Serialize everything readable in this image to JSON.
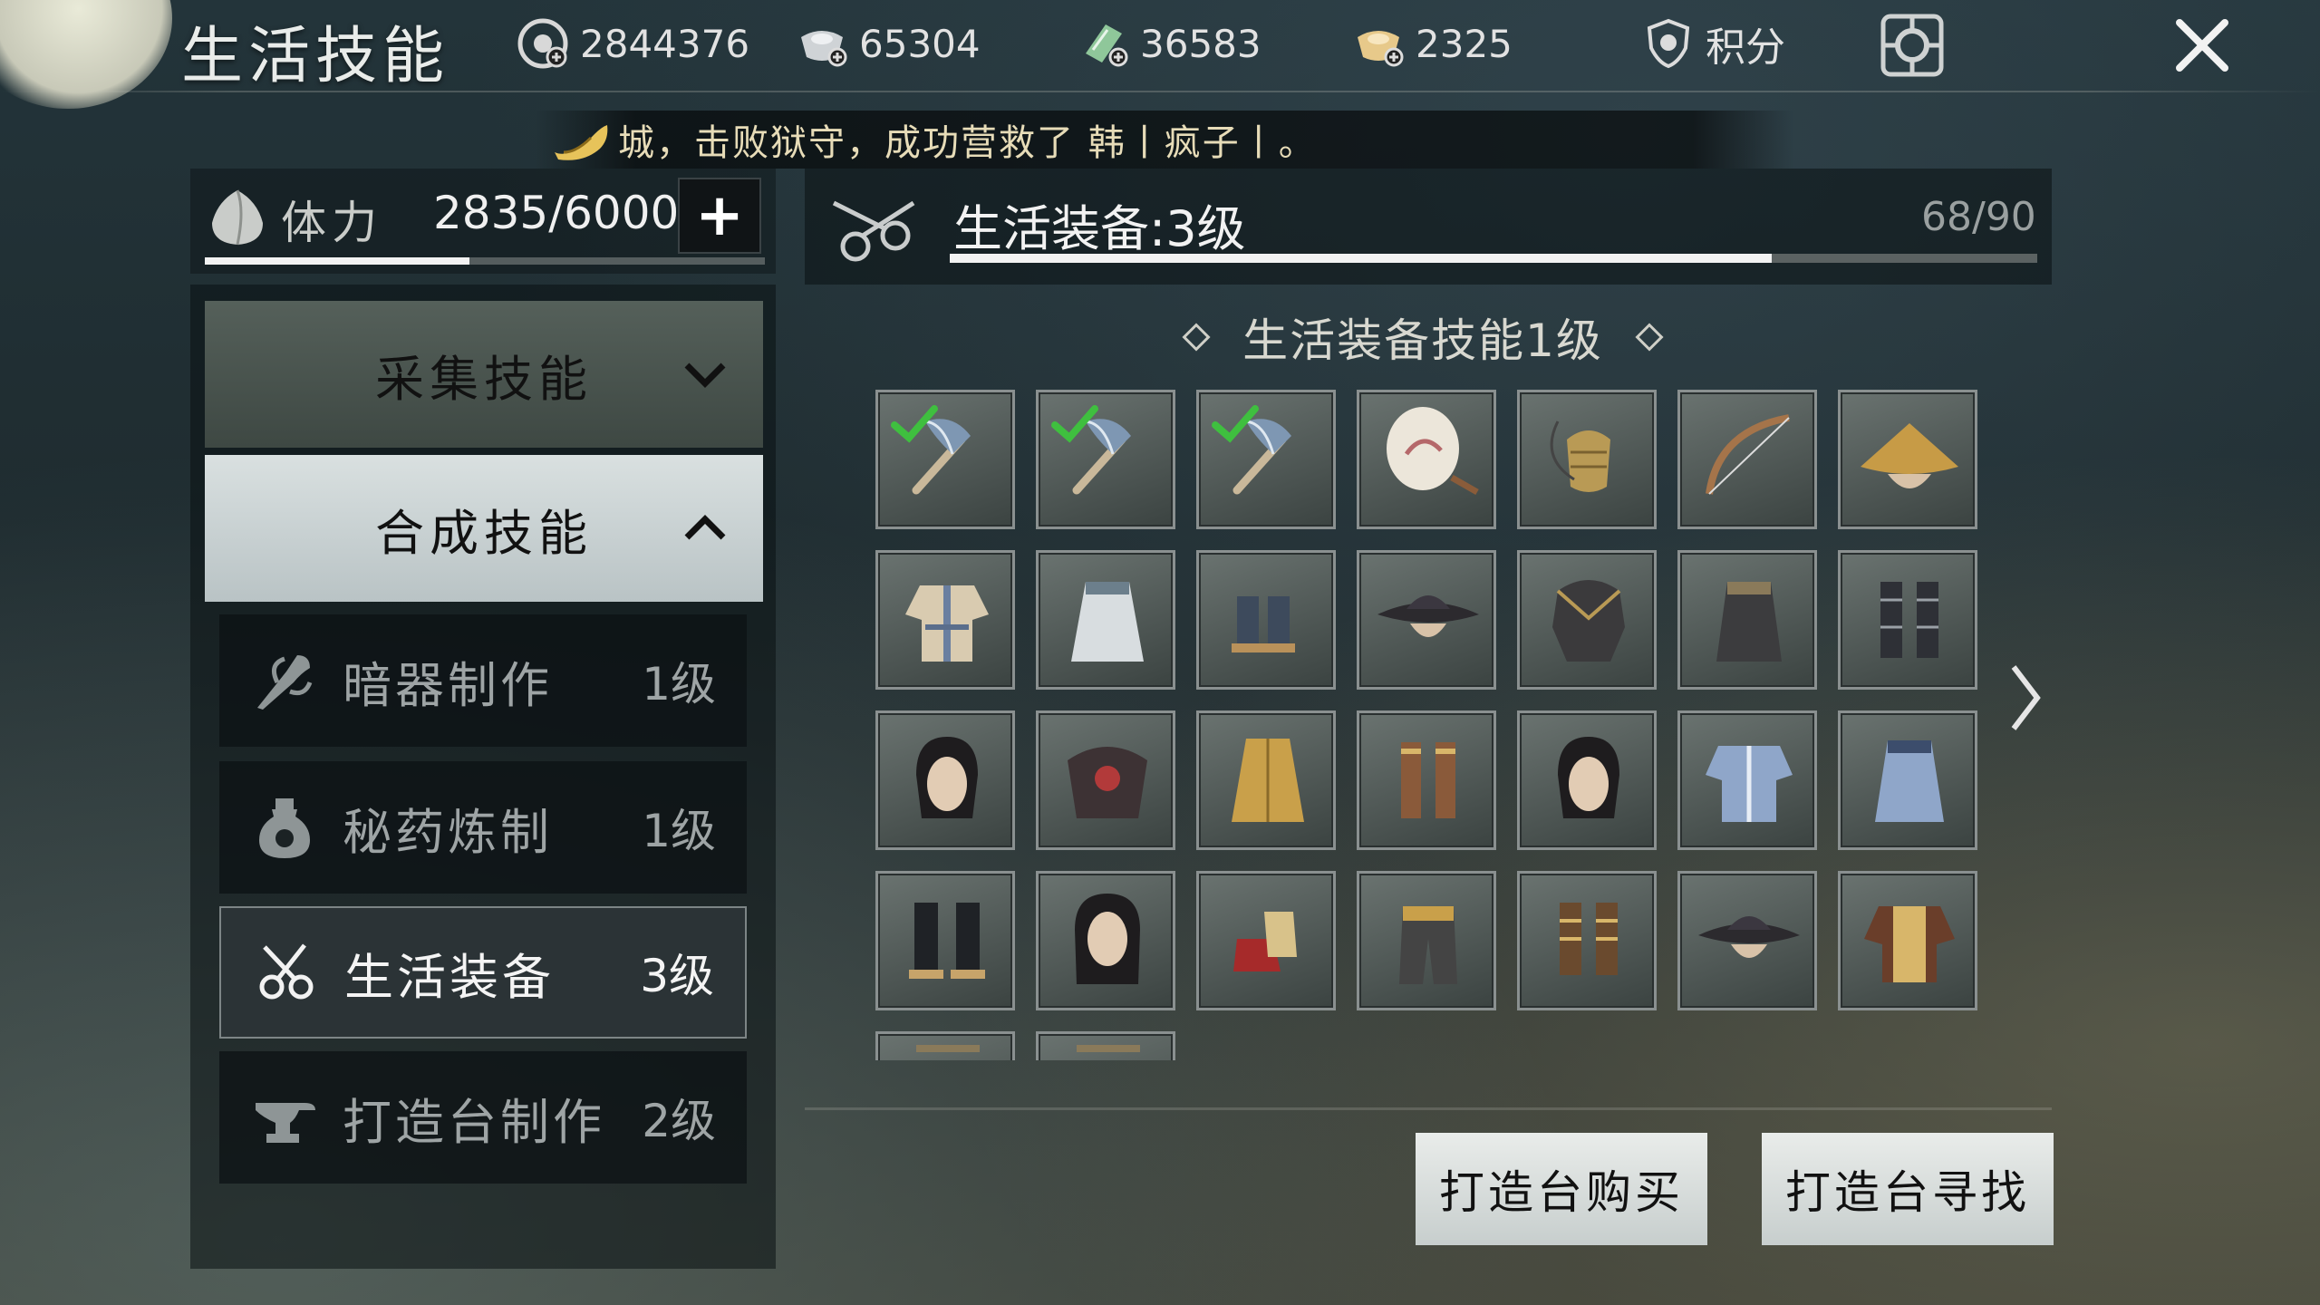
{
  "header": {
    "title": "生活技能",
    "resources": [
      {
        "icon": "coin-icon",
        "value": "2844376"
      },
      {
        "icon": "silver-ingot-icon",
        "value": "65304"
      },
      {
        "icon": "jade-icon",
        "value": "36583"
      },
      {
        "icon": "gold-ingot-icon",
        "value": "2325"
      }
    ],
    "points_label": "积分"
  },
  "marquee": {
    "text": "城，击败狱守，成功营救了 韩丨疯子丨。"
  },
  "stamina": {
    "label": "体力",
    "value": "2835/6000",
    "fraction": 0.4725
  },
  "menu": {
    "categories": [
      {
        "label": "采集技能",
        "expanded": false
      },
      {
        "label": "合成技能",
        "expanded": true
      }
    ],
    "subskills": [
      {
        "label": "暗器制作",
        "level": "1级",
        "icon": "dart-icon"
      },
      {
        "label": "秘药炼制",
        "level": "1级",
        "icon": "medicine-bottle-icon"
      },
      {
        "label": "生活装备",
        "level": "3级",
        "icon": "scissors-icon",
        "active": true
      },
      {
        "label": "打造台制作",
        "level": "2级",
        "icon": "anvil-icon"
      }
    ]
  },
  "skill": {
    "title": "生活装备:3级",
    "progress_text": "68/90",
    "progress_fraction": 0.7556,
    "section_title": "生活装备技能1级"
  },
  "grid": {
    "items": [
      {
        "icon": "axe-icon",
        "unlocked": true
      },
      {
        "icon": "axe-icon",
        "unlocked": true
      },
      {
        "icon": "axe-icon",
        "unlocked": true
      },
      {
        "icon": "fan-icon"
      },
      {
        "icon": "fish-basket-icon"
      },
      {
        "icon": "bow-icon"
      },
      {
        "icon": "straw-hat-icon"
      },
      {
        "icon": "robe-icon"
      },
      {
        "icon": "white-skirt-icon"
      },
      {
        "icon": "shoes-icon"
      },
      {
        "icon": "dark-hat-icon"
      },
      {
        "icon": "armor-icon"
      },
      {
        "icon": "dark-skirt-icon"
      },
      {
        "icon": "greaves-icon"
      },
      {
        "icon": "hairstyle-icon"
      },
      {
        "icon": "fur-armor-icon"
      },
      {
        "icon": "gold-skirt-icon"
      },
      {
        "icon": "bracers-icon"
      },
      {
        "icon": "hairstyle-icon"
      },
      {
        "icon": "blue-armor-icon"
      },
      {
        "icon": "blue-skirt-icon"
      },
      {
        "icon": "boots-icon"
      },
      {
        "icon": "long-hair-icon"
      },
      {
        "icon": "red-shoes-icon"
      },
      {
        "icon": "gold-pants-icon"
      },
      {
        "icon": "sandals-icon"
      },
      {
        "icon": "dark-hat-icon"
      },
      {
        "icon": "gold-robe-icon"
      },
      {
        "icon": "partial-item-icon"
      },
      {
        "icon": "partial-item-icon"
      }
    ]
  },
  "buttons": {
    "buy": "打造台购买",
    "find": "打造台寻找"
  },
  "colors": {
    "accent": "#f2f2f2",
    "check": "#3fbf3f",
    "panel": "#0a1012"
  }
}
